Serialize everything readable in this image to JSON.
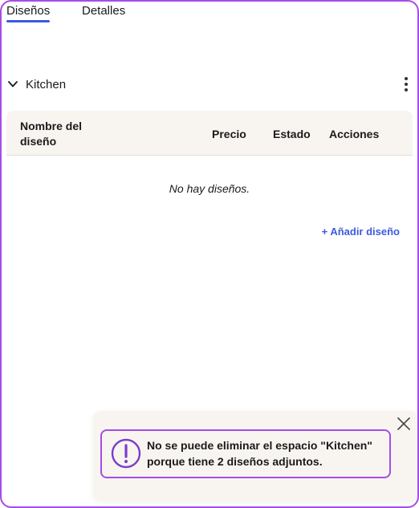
{
  "tabs": [
    {
      "label": "Diseños",
      "active": true
    },
    {
      "label": "Detalles",
      "active": false
    }
  ],
  "section": {
    "title": "Kitchen"
  },
  "table": {
    "columns": [
      "Nombre del diseño",
      "Precio",
      "Estado",
      "Acciones"
    ],
    "empty_message": "No hay diseños."
  },
  "actions": {
    "add_design_label": "+ Añadir diseño"
  },
  "toast": {
    "message": "No se puede eliminar el espacio \"Kitchen\" porque tiene 2 diseños adjuntos."
  },
  "colors": {
    "accent": "#3d5ae0",
    "frame_border": "#a64ce6",
    "alert_border": "#a64ce6",
    "header_bg": "#f8f5f1"
  },
  "icons": {
    "section_toggle": "chevron-down-icon",
    "section_menu": "kebab-menu-icon",
    "toast_close": "close-icon",
    "alert": "exclamation-circle-icon"
  }
}
